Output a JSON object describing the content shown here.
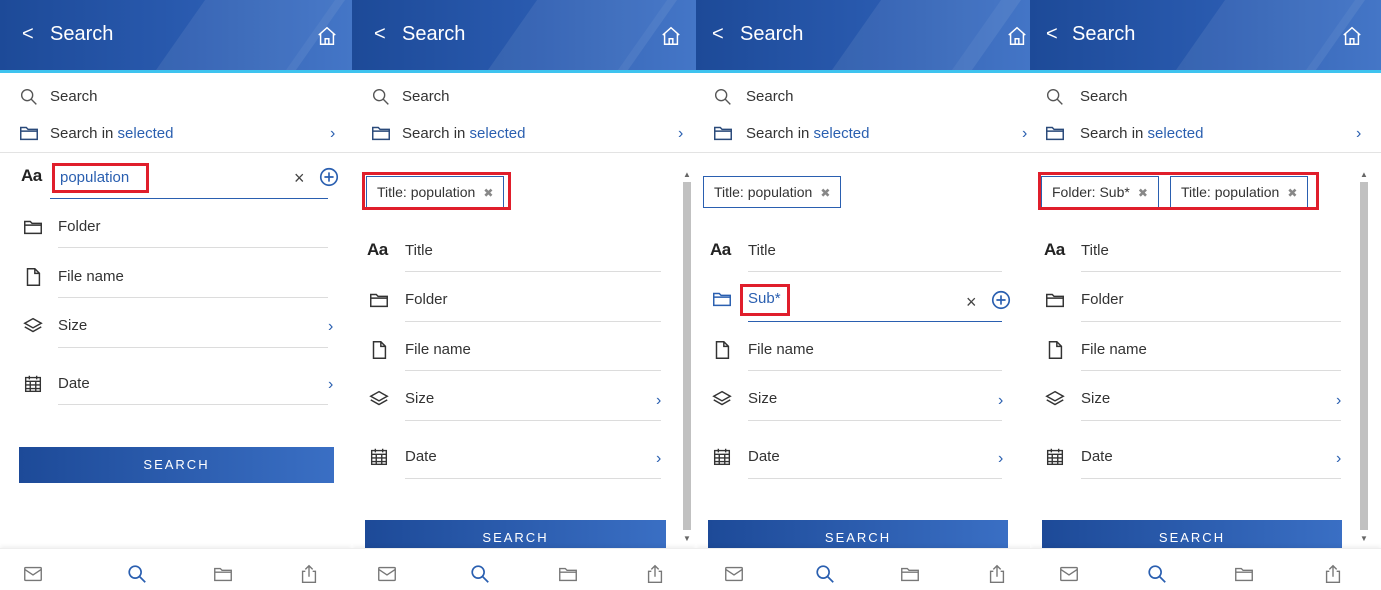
{
  "header": {
    "title": "Search",
    "back_glyph": "<",
    "home_icon": "home-icon"
  },
  "menu": {
    "search_label": "Search",
    "search_in_prefix": "Search in ",
    "search_in_selected": "selected",
    "chevron": "›"
  },
  "fields": {
    "title": "Title",
    "title_glyph": "Aa",
    "folder": "Folder",
    "file_name": "File name",
    "size": "Size",
    "date": "Date"
  },
  "inputs": {
    "title_value": "population",
    "folder_value": "Sub*",
    "clear_glyph": "×"
  },
  "chips": {
    "title_population": "Title: population",
    "folder_sub": "Folder: Sub*",
    "remove_glyph": "✖"
  },
  "search_button": "SEARCH",
  "bottom_nav": [
    "mail-icon",
    "search-icon",
    "folder-icon",
    "share-icon"
  ],
  "colors": {
    "header": "#1d4a98",
    "accent": "#2a5fb0",
    "highlight": "#e01e2b",
    "header_line": "#3ec3ef"
  }
}
